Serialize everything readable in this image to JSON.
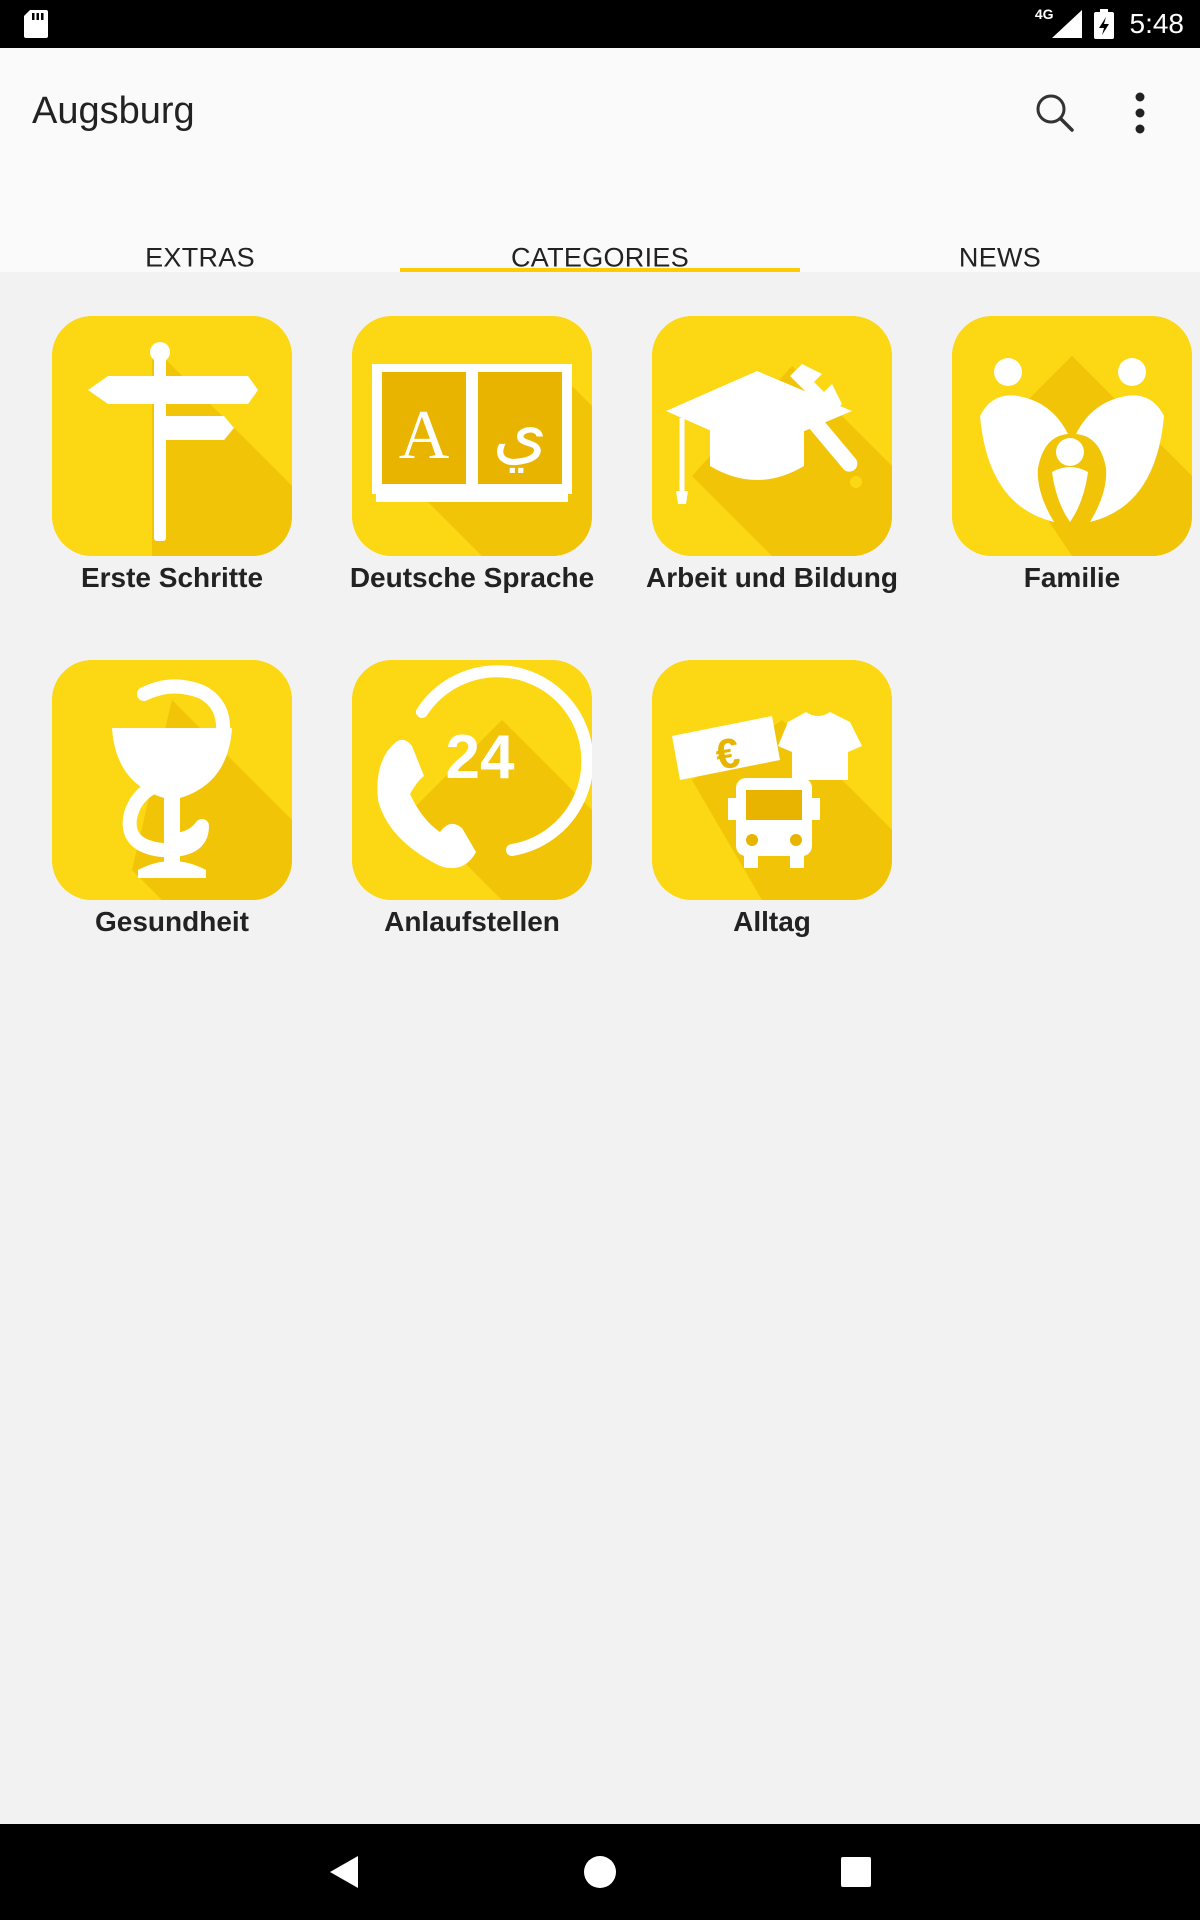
{
  "status": {
    "network": "4G",
    "time": "5:48"
  },
  "app": {
    "title": "Augsburg"
  },
  "tabs": [
    {
      "label": "EXTRAS",
      "active": false
    },
    {
      "label": "CATEGORIES",
      "active": true
    },
    {
      "label": "NEWS",
      "active": false
    }
  ],
  "categories": [
    {
      "label": "Erste Schritte",
      "icon": "signpost-icon"
    },
    {
      "label": "Deutsche Sprache",
      "icon": "book-icon"
    },
    {
      "label": "Arbeit und Bildung",
      "icon": "graduation-tools-icon"
    },
    {
      "label": "Familie",
      "icon": "family-icon"
    },
    {
      "label": "Gesundheit",
      "icon": "caduceus-icon"
    },
    {
      "label": "Anlaufstellen",
      "icon": "phone-24-icon"
    },
    {
      "label": "Alltag",
      "icon": "everyday-icon"
    }
  ],
  "icon_glyphs": {
    "book_left": "A",
    "book_right": "ي",
    "phone_hours": "24",
    "currency": "€"
  },
  "colors": {
    "accent": "#ffcc00",
    "tile": "#fcd713",
    "tile_shadow": "#e8b400",
    "background": "#f2f2f2"
  }
}
